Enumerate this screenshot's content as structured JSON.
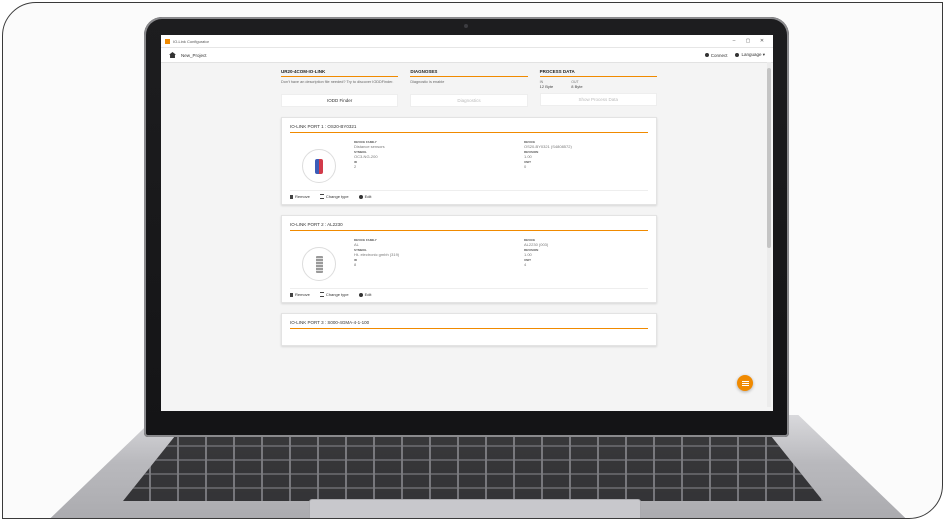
{
  "window": {
    "title": "IO-Link Configurator",
    "controls": [
      "–",
      "▢",
      "✕"
    ]
  },
  "toolbar": {
    "project": "New_Project",
    "connect": "Connect",
    "language": "Language ▾"
  },
  "summary": {
    "device": {
      "heading": "UR20-4COM-IO-LINK",
      "text": "Don't have an description file needed? Try to discover IODDFinder.",
      "button": "IODD Finder"
    },
    "diagnostics": {
      "heading": "DIAGNOSES",
      "text": "Diagnostic is enable",
      "button": "Diagnostics"
    },
    "process_data": {
      "heading": "PROCESS DATA",
      "in_label": "IN",
      "in_value": "12 Byte",
      "out_label": "OUT",
      "out_value": "8 Byte",
      "button": "Show Process Data"
    }
  },
  "ports": [
    {
      "title": "IO-LINK PORT 1 : OS20-BY0321",
      "left_labels": [
        "DEVICE FAMILY",
        "SYMBOL",
        "ID"
      ],
      "left_values": [
        "Distance sensors",
        "OC3-NG-200",
        "2"
      ],
      "right_labels": [
        "DEVICE",
        "REVISION",
        "UNIT"
      ],
      "right_values": [
        "OS20-BY0321 (S4808572)",
        "1.00",
        "0"
      ],
      "image": "blue-red-sensor"
    },
    {
      "title": "IO-LINK PORT 2 : AL2230",
      "left_labels": [
        "DEVICE FAMILY",
        "SYMBOL",
        "ID"
      ],
      "left_values": [
        "AL",
        "Ht- electronic gmbh (319)",
        "8"
      ],
      "right_labels": [
        "DEVICE",
        "REVISION",
        "UNIT"
      ],
      "right_values": [
        "AL2230 (003)",
        "1.00",
        "4"
      ],
      "image": "grey-light-stack"
    }
  ],
  "card_actions": {
    "remove": "Remove",
    "change_type": "Change type",
    "edit": "Edit"
  },
  "partial_card": {
    "title": "IO-LINK PORT 3 : S000-4GMA-4-1-100"
  },
  "colors": {
    "accent": "#f08a00",
    "background": "#f4f4f4"
  },
  "icons": {
    "home": "home-icon",
    "fab": "menu-icon"
  }
}
